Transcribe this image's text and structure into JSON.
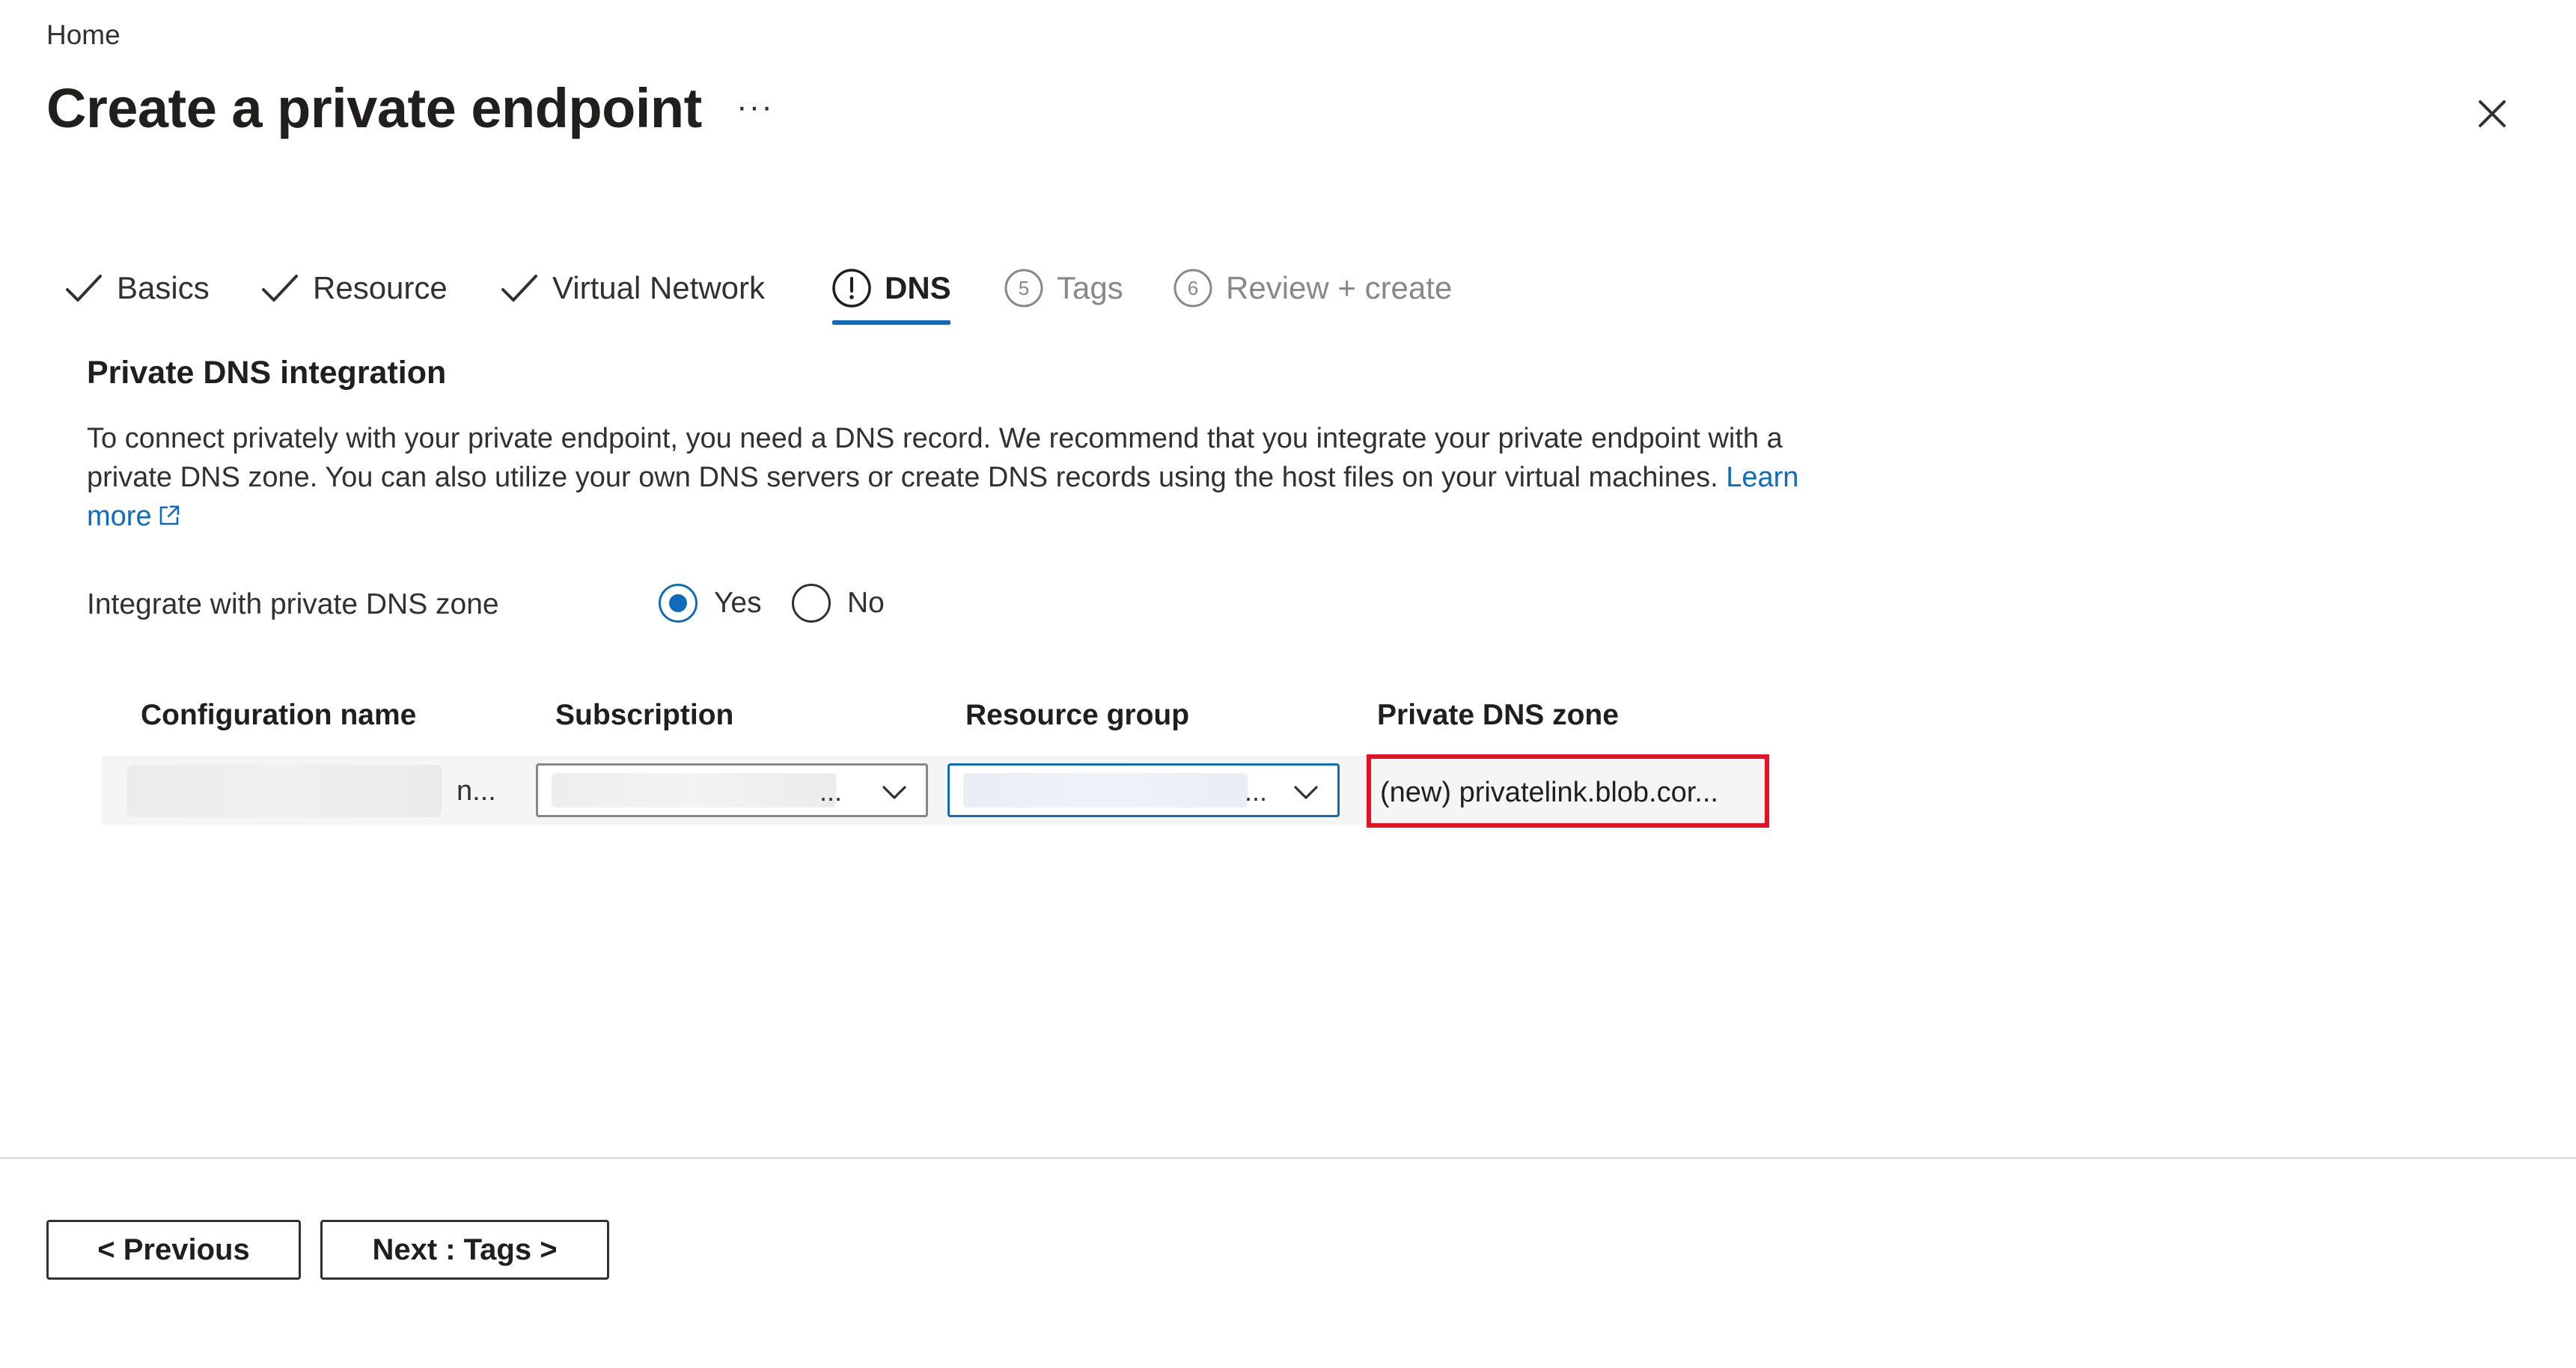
{
  "breadcrumb": {
    "home": "Home"
  },
  "header": {
    "title": "Create a private endpoint",
    "more_label": "···"
  },
  "tabs": [
    {
      "label": "Basics",
      "state": "done",
      "icon": "checkmark-icon"
    },
    {
      "label": "Resource",
      "state": "done",
      "icon": "checkmark-icon"
    },
    {
      "label": "Virtual Network",
      "state": "done",
      "icon": "checkmark-icon"
    },
    {
      "label": "DNS",
      "state": "active",
      "icon": "warning-circle-icon",
      "icon_text": "!"
    },
    {
      "label": "Tags",
      "state": "pending",
      "icon": "step-number-icon",
      "icon_text": "5"
    },
    {
      "label": "Review + create",
      "state": "pending",
      "icon": "step-number-icon",
      "icon_text": "6"
    }
  ],
  "section": {
    "heading": "Private DNS integration",
    "description": "To connect privately with your private endpoint, you need a DNS record. We recommend that you integrate your private endpoint with a private DNS zone. You can also utilize your own DNS servers or create DNS records using the host files on your virtual machines.",
    "learn_more": "Learn more"
  },
  "integrate": {
    "label": "Integrate with private DNS zone",
    "options": [
      {
        "label": "Yes",
        "selected": true
      },
      {
        "label": "No",
        "selected": false
      }
    ]
  },
  "table": {
    "columns": [
      "Configuration name",
      "Subscription",
      "Resource group",
      "Private DNS zone"
    ],
    "row": {
      "config_name": "n...",
      "subscription": "...",
      "resource_group": "...",
      "dns_zone": "(new) privatelink.blob.cor..."
    }
  },
  "footer": {
    "previous": "< Previous",
    "next": "Next : Tags >"
  },
  "colors": {
    "accent": "#0f6cbd",
    "highlight": "#e81123",
    "text": "#323130",
    "muted": "#8a8886"
  }
}
